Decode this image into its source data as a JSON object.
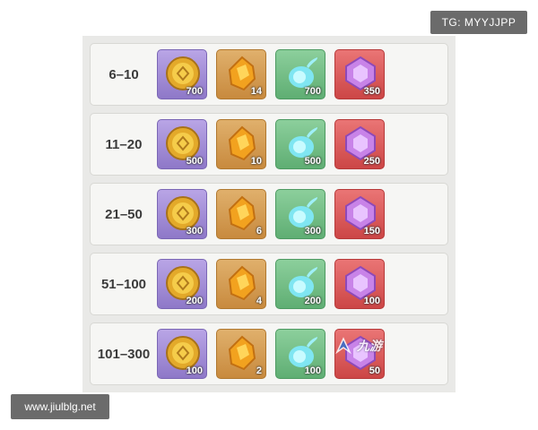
{
  "watermark_top": "TG: MYYJJPP",
  "watermark_bottom": "www.jiulblg.net",
  "overlay_logo_text": "九游",
  "colors": {
    "coin_tile": "#8e78c8",
    "ore_tile": "#c88a3e",
    "spirit_tile": "#5fae73",
    "gem_tile": "#cc4646"
  },
  "icons": [
    "gold-coin-icon",
    "gold-ore-icon",
    "blue-spirit-icon",
    "purple-gem-icon"
  ],
  "tiers": [
    {
      "rank": "6–10",
      "coin": "700",
      "ore": "14",
      "spirit": "700",
      "gem": "350"
    },
    {
      "rank": "11–20",
      "coin": "500",
      "ore": "10",
      "spirit": "500",
      "gem": "250"
    },
    {
      "rank": "21–50",
      "coin": "300",
      "ore": "6",
      "spirit": "300",
      "gem": "150"
    },
    {
      "rank": "51–100",
      "coin": "200",
      "ore": "4",
      "spirit": "200",
      "gem": "100"
    },
    {
      "rank": "101–300",
      "coin": "100",
      "ore": "2",
      "spirit": "100",
      "gem": "50"
    }
  ]
}
